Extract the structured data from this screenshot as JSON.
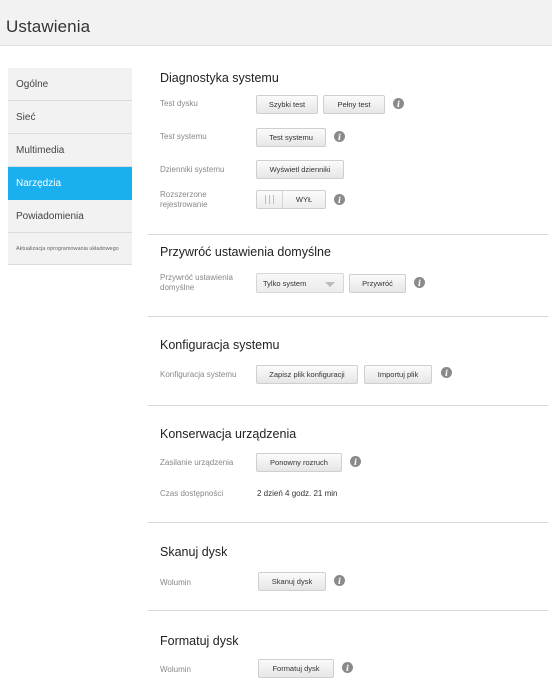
{
  "header": {
    "title": "Ustawienia"
  },
  "sidebar": {
    "items": [
      {
        "label": "Ogólne"
      },
      {
        "label": "Sieć"
      },
      {
        "label": "Multimedia"
      },
      {
        "label": "Narzędzia",
        "active": true
      },
      {
        "label": "Powiadomienia"
      },
      {
        "label": "Aktualizacja oprogramowania układowego"
      }
    ]
  },
  "diagnostics": {
    "title": "Diagnostyka systemu",
    "disk_test_label": "Test dysku",
    "quick_test": "Szybki test",
    "full_test": "Pełny test",
    "system_test_label": "Test systemu",
    "system_test_button": "Test systemu",
    "logs_label": "Dzienniki systemu",
    "logs_button": "Wyświetl dzienniki",
    "extended_logging_label_1": "Rozszerzone",
    "extended_logging_label_2": "rejestrowanie",
    "extended_logging_state": "WYŁ"
  },
  "restore": {
    "title": "Przywróć ustawienia domyślne",
    "label_1": "Przywróć ustawienia",
    "label_2": "domyślne",
    "select_value": "Tylko system",
    "button": "Przywróć"
  },
  "config": {
    "title": "Konfiguracja systemu",
    "label": "Konfiguracja systemu",
    "save_button": "Zapisz plik konfiguracji",
    "import_button": "Importuj plik"
  },
  "maintenance": {
    "title": "Konserwacja urządzenia",
    "power_label": "Zasilanie urządzenia",
    "reboot_button": "Ponowny rozruch",
    "uptime_label": "Czas dostępności",
    "uptime_value": "2 dzień 4 godz. 21 min"
  },
  "scan": {
    "title": "Skanuj dysk",
    "volume_label": "Wolumin",
    "button": "Skanuj dysk"
  },
  "format": {
    "title": "Formatuj dysk",
    "volume_label": "Wolumin",
    "button": "Formatuj dysk"
  },
  "icons": {
    "info": "info-icon"
  },
  "colors": {
    "accent": "#1ab0f0",
    "header_bg": "#f2f2f2",
    "info_icon": "#8a8a8a"
  }
}
